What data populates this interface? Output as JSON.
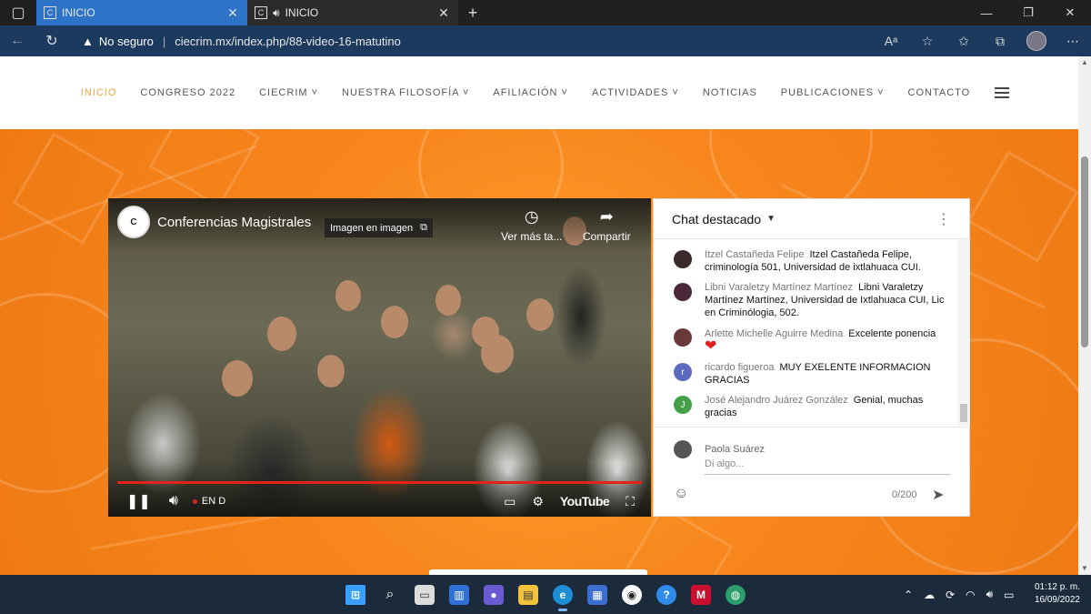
{
  "browser": {
    "tabs": [
      {
        "label": "INICIO",
        "active": true,
        "speaker": false
      },
      {
        "label": "INICIO",
        "active": false,
        "speaker": true
      }
    ],
    "security_label": "No seguro",
    "url": "ciecrim.mx/index.php/88-video-16-matutino"
  },
  "site": {
    "nav": [
      {
        "label": "INICIO",
        "active": true,
        "caret": false
      },
      {
        "label": "CONGRESO 2022",
        "active": false,
        "caret": false
      },
      {
        "label": "CIECRIM",
        "active": false,
        "caret": true
      },
      {
        "label": "NUESTRA FILOSOFÍA",
        "active": false,
        "caret": true
      },
      {
        "label": "AFILIACIÓN",
        "active": false,
        "caret": true
      },
      {
        "label": "ACTIVIDADES",
        "active": false,
        "caret": true
      },
      {
        "label": "NOTICIAS",
        "active": false,
        "caret": false
      },
      {
        "label": "PUBLICACIONES",
        "active": false,
        "caret": true
      },
      {
        "label": "CONTACTO",
        "active": false,
        "caret": false
      }
    ],
    "accent": "#f2a33a"
  },
  "video": {
    "title": "Conferencias Magistrales",
    "pip_label": "Imagen en imagen",
    "watch_later": "Ver más ta...",
    "share": "Compartir",
    "live_label": "EN D",
    "youtube_label": "YouTube"
  },
  "chat": {
    "title": "Chat destacado",
    "messages": [
      {
        "author": "Itzel Castañeda Felipe",
        "text": "Itzel Castañeda Felipe, criminología 501, Universidad de ixtlahuaca CUI.",
        "avatar_color": "#3a2a2a",
        "initial": ""
      },
      {
        "author": "Libni Varaletzy Martínez Martínez",
        "text": "Libni Varaletzy Martínez Martínez, Universidad de Ixtlahuaca CUI, Lic en Criminólogia, 502.",
        "avatar_color": "#4a2a3a",
        "initial": ""
      },
      {
        "author": "Arlette Michelle Aguirre Medina",
        "text": "Excelente ponencia",
        "avatar_color": "#6a3a3a",
        "initial": "",
        "heart": true
      },
      {
        "author": "ricardo figueroa",
        "text": "MUY EXELENTE INFORMACION GRACIAS",
        "avatar_color": "#5c6bc0",
        "initial": "r"
      },
      {
        "author": "José Alejandro Juárez González",
        "text": "Genial, muchas gracias",
        "avatar_color": "#43a047",
        "initial": "J"
      }
    ],
    "current_user": "Paola Suárez",
    "input_placeholder": "Di algo...",
    "char_count": "0/200"
  },
  "taskbar": {
    "time": "01:12 p. m.",
    "date": "16/09/2022"
  }
}
